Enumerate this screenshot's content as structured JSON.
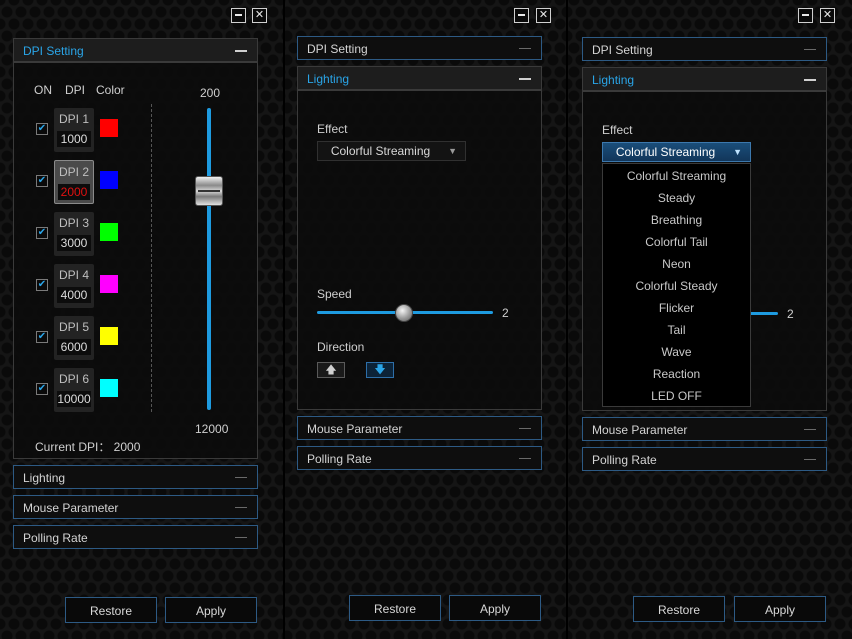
{
  "common": {
    "window_buttons": {
      "minimize": "minimize-icon",
      "close": "✕"
    },
    "sections": {
      "dpi": "DPI Setting",
      "lighting": "Lighting",
      "mouse": "Mouse Parameter",
      "polling": "Polling Rate"
    },
    "buttons": {
      "restore": "Restore",
      "apply": "Apply"
    },
    "accent_color": "#1e9be0"
  },
  "panel1": {
    "headers": {
      "on": "ON",
      "dpi": "DPI",
      "color": "Color"
    },
    "levels": [
      {
        "name": "DPI 1",
        "value": "1000",
        "color": "#ff0000",
        "checked": true,
        "selected": false
      },
      {
        "name": "DPI 2",
        "value": "2000",
        "color": "#0000ff",
        "checked": true,
        "selected": true
      },
      {
        "name": "DPI 3",
        "value": "3000",
        "color": "#00ff00",
        "checked": true,
        "selected": false
      },
      {
        "name": "DPI 4",
        "value": "4000",
        "color": "#ff00ff",
        "checked": true,
        "selected": false
      },
      {
        "name": "DPI 5",
        "value": "6000",
        "color": "#ffff00",
        "checked": true,
        "selected": false
      },
      {
        "name": "DPI 6",
        "value": "10000",
        "color": "#00ffff",
        "checked": true,
        "selected": false
      }
    ],
    "slider": {
      "min_label": "200",
      "max_label": "12000",
      "value": 2000
    },
    "current_dpi": "Current DPI： 2000"
  },
  "panel2": {
    "effect_label": "Effect",
    "effect_value": "Colorful Streaming",
    "speed_label": "Speed",
    "speed_value": "2",
    "direction_label": "Direction",
    "direction": {
      "up": "🡅",
      "down": "🡇",
      "active": "down"
    }
  },
  "panel3": {
    "effect_label": "Effect",
    "effect_value": "Colorful Streaming",
    "speed_value": "2",
    "options": [
      "Colorful Streaming",
      "Steady",
      "Breathing",
      "Colorful Tail",
      "Neon",
      "Colorful Steady",
      "Flicker",
      "Tail",
      "Wave",
      "Reaction",
      "LED OFF"
    ]
  }
}
